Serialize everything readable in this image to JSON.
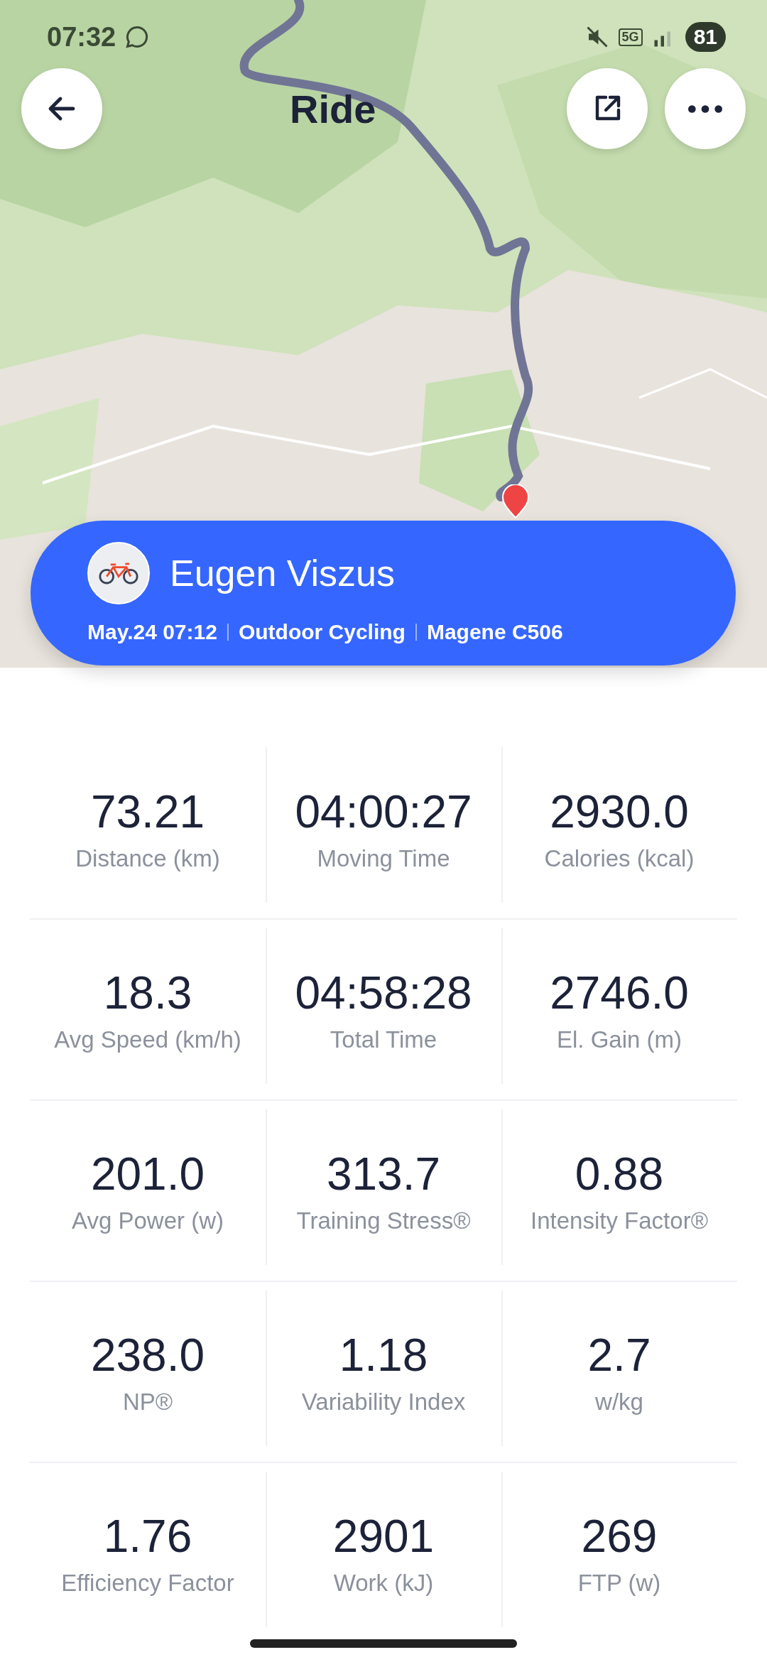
{
  "status_bar": {
    "time": "07:32",
    "network": "5G",
    "battery": "81"
  },
  "header": {
    "title": "Ride"
  },
  "activity": {
    "athlete": "Eugen Viszus",
    "details": [
      "May.24 07:12",
      "Outdoor Cycling",
      "Magene C506"
    ]
  },
  "stats": [
    {
      "value": "73.21",
      "label": "Distance (km)"
    },
    {
      "value": "04:00:27",
      "label": "Moving Time"
    },
    {
      "value": "2930.0",
      "label": "Calories (kcal)"
    },
    {
      "value": "18.3",
      "label": "Avg Speed (km/h)"
    },
    {
      "value": "04:58:28",
      "label": "Total Time"
    },
    {
      "value": "2746.0",
      "label": "El. Gain (m)"
    },
    {
      "value": "201.0",
      "label": "Avg Power (w)"
    },
    {
      "value": "313.7",
      "label": "Training Stress®"
    },
    {
      "value": "0.88",
      "label": "Intensity Factor®"
    },
    {
      "value": "238.0",
      "label": "NP®"
    },
    {
      "value": "1.18",
      "label": "Variability Index"
    },
    {
      "value": "2.7",
      "label": "w/kg"
    },
    {
      "value": "1.76",
      "label": "Efficiency Factor"
    },
    {
      "value": "2901",
      "label": "Work (kJ)"
    },
    {
      "value": "269",
      "label": "FTP (w)"
    }
  ]
}
